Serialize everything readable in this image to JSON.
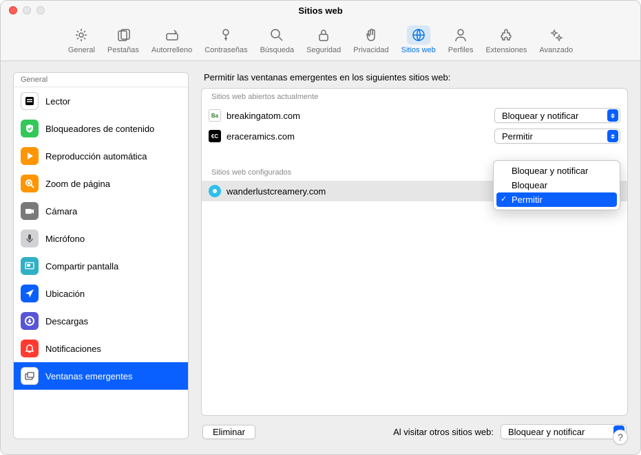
{
  "window_title": "Sitios web",
  "toolbar": [
    {
      "id": "general",
      "label": "General"
    },
    {
      "id": "pestanas",
      "label": "Pestañas"
    },
    {
      "id": "autorrelleno",
      "label": "Autorrelleno"
    },
    {
      "id": "contrasenas",
      "label": "Contraseñas"
    },
    {
      "id": "busqueda",
      "label": "Búsqueda"
    },
    {
      "id": "seguridad",
      "label": "Seguridad"
    },
    {
      "id": "privacidad",
      "label": "Privacidad"
    },
    {
      "id": "sitiosweb",
      "label": "Sitios web",
      "active": true
    },
    {
      "id": "perfiles",
      "label": "Perfiles"
    },
    {
      "id": "extensiones",
      "label": "Extensiones"
    },
    {
      "id": "avanzado",
      "label": "Avanzado"
    }
  ],
  "sidebar": {
    "header": "General",
    "items": [
      {
        "id": "lector",
        "label": "Lector",
        "bg": "#ffffff",
        "fg": "#000"
      },
      {
        "id": "bloqueadores",
        "label": "Bloqueadores de contenido",
        "bg": "#34c759"
      },
      {
        "id": "reproduccion",
        "label": "Reproducción automática",
        "bg": "#ff9500"
      },
      {
        "id": "zoom",
        "label": "Zoom de página",
        "bg": "#ff9500"
      },
      {
        "id": "camara",
        "label": "Cámara",
        "bg": "#7a7a7a"
      },
      {
        "id": "microfono",
        "label": "Micrófono",
        "bg": "#d1d1d6",
        "fg": "#555"
      },
      {
        "id": "compartir",
        "label": "Compartir pantalla",
        "bg": "#30b0c7"
      },
      {
        "id": "ubicacion",
        "label": "Ubicación",
        "bg": "#0a60ff"
      },
      {
        "id": "descargas",
        "label": "Descargas",
        "bg": "#5856d6"
      },
      {
        "id": "notificaciones",
        "label": "Notificaciones",
        "bg": "#ff3b30"
      },
      {
        "id": "ventanas",
        "label": "Ventanas emergentes",
        "bg": "#ffffff",
        "fg": "#555",
        "selected": true
      }
    ]
  },
  "main": {
    "heading": "Permitir las ventanas emergentes en los siguientes sitios web:",
    "open_header": "Sitios web abiertos actualmente",
    "configured_header": "Sitios web configurados",
    "open_sites": [
      {
        "name": "breakingatom.com",
        "option": "Bloquear y notificar",
        "favicon_bg": "#fff",
        "favicon_txt": "Ba",
        "favicon_color": "#2e7d32",
        "favicon_border": true
      },
      {
        "name": "eraceramics.com",
        "option": "Permitir",
        "favicon_bg": "#000",
        "favicon_txt": "€C",
        "favicon_color": "#fff"
      }
    ],
    "configured_sites": [
      {
        "name": "wanderlustcreamery.com",
        "option": "Permitir",
        "highlighted": true,
        "favicon_bg": "#2ec0ee",
        "favicon_txt": "",
        "favicon_color": "#fff",
        "dot": true
      }
    ],
    "dropdown": {
      "items": [
        "Bloquear y notificar",
        "Bloquear",
        "Permitir"
      ],
      "selected": "Permitir"
    },
    "remove_btn": "Eliminar",
    "footer_label": "Al visitar otros sitios web:",
    "footer_option": "Bloquear y notificar"
  },
  "help": "?"
}
